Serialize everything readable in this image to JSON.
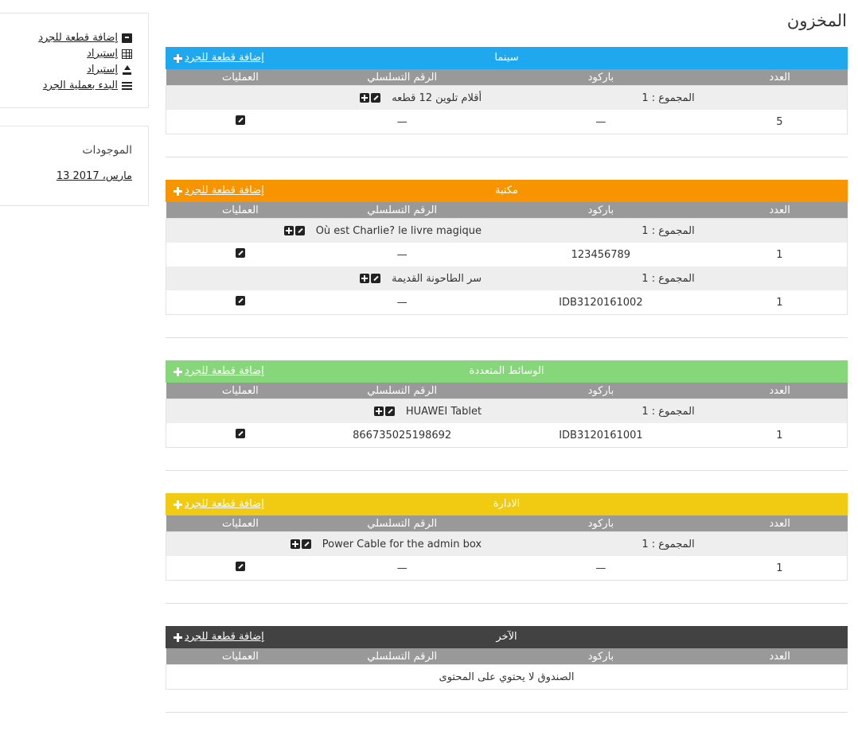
{
  "page_title": "المخزون",
  "sidebar": {
    "actions": [
      {
        "label": "إضافة قطعة للجرد",
        "icon": "archive-icon"
      },
      {
        "label": "إستيراد",
        "icon": "table-icon"
      },
      {
        "label": "إستيراد",
        "icon": "upload-icon"
      },
      {
        "label": "البدء بعملية الجرد",
        "icon": "list-icon"
      }
    ],
    "assets_heading": "الموجودات",
    "assets_date": "13 مارس، 2017"
  },
  "table_headers": {
    "count": "العدد",
    "barcode": "باركود",
    "serial": "الرقم التسلسلي",
    "operations": "العمليات"
  },
  "add_label": "إضافة قطعة للجرد",
  "sections": [
    {
      "name": "سينما",
      "color": "#20a8ef",
      "groups": [
        {
          "total": "المجموع : 1",
          "title": "أقلام تلوين 12 قطعه",
          "items": [
            {
              "count": "5",
              "barcode": "—",
              "serial": "—"
            }
          ]
        }
      ]
    },
    {
      "name": "مكتبة",
      "color": "#f79400",
      "groups": [
        {
          "total": "المجموع : 1",
          "title": "Où est Charlie? le livre magique",
          "items": [
            {
              "count": "1",
              "barcode": "123456789",
              "serial": "—"
            }
          ]
        },
        {
          "total": "المجموع : 1",
          "title": "سر الطاحونة القديمة",
          "items": [
            {
              "count": "1",
              "barcode": "IDB3120161002",
              "serial": "—"
            }
          ]
        }
      ]
    },
    {
      "name": "الوسائط المتعددة",
      "color": "#86d67a",
      "groups": [
        {
          "total": "المجموع : 1",
          "title": "HUAWEI Tablet",
          "items": [
            {
              "count": "1",
              "barcode": "IDB3120161001",
              "serial": "86673502519869 2"
            }
          ]
        }
      ]
    },
    {
      "name": "الادارة",
      "color": "#f0cb12",
      "groups": [
        {
          "total": "المجموع : 1",
          "title": "Power Cable for the admin box",
          "items": [
            {
              "count": "1",
              "barcode": "—",
              "serial": "—"
            }
          ]
        }
      ]
    },
    {
      "name": "الآخر",
      "color": "#424242",
      "groups": [],
      "empty_text": "الصندوق لا يحتوي على المحتوى"
    }
  ]
}
